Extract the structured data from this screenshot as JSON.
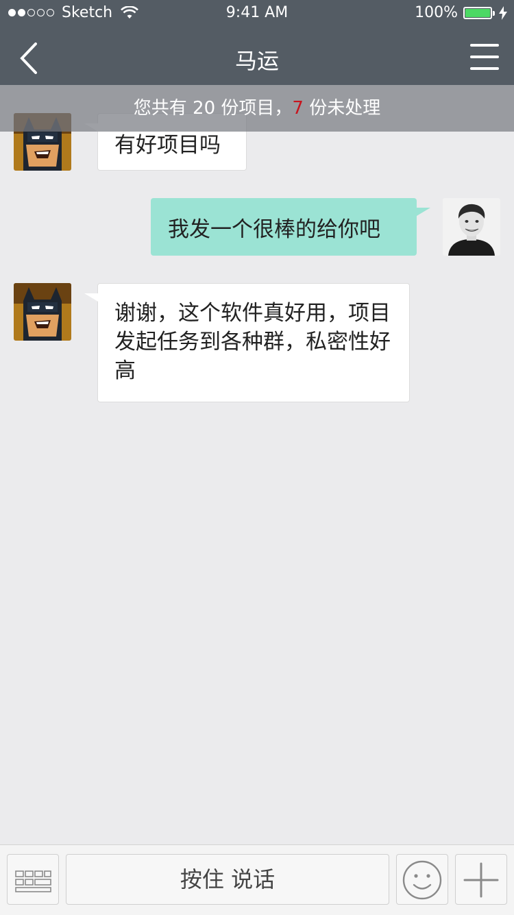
{
  "status_bar": {
    "carrier": "Sketch",
    "time": "9:41 AM",
    "battery": "100%"
  },
  "nav": {
    "title": "马运"
  },
  "notice": {
    "prefix": "您共有 20 份项目，",
    "count": "7",
    "suffix": " 份未处理"
  },
  "messages": [
    {
      "side": "incoming",
      "text": "有好项目吗"
    },
    {
      "side": "outgoing",
      "text": "我发一个很棒的给你吧"
    },
    {
      "side": "incoming",
      "text": "谢谢，这个软件真好用，项目发起任务到各种群，私密性好高"
    }
  ],
  "input_bar": {
    "talk_label": "按住 说话"
  },
  "colors": {
    "nav_bg": "#545c64",
    "outgoing_bubble": "#9be3d4",
    "accent_red": "#c8141e",
    "battery_green": "#4cd964"
  }
}
